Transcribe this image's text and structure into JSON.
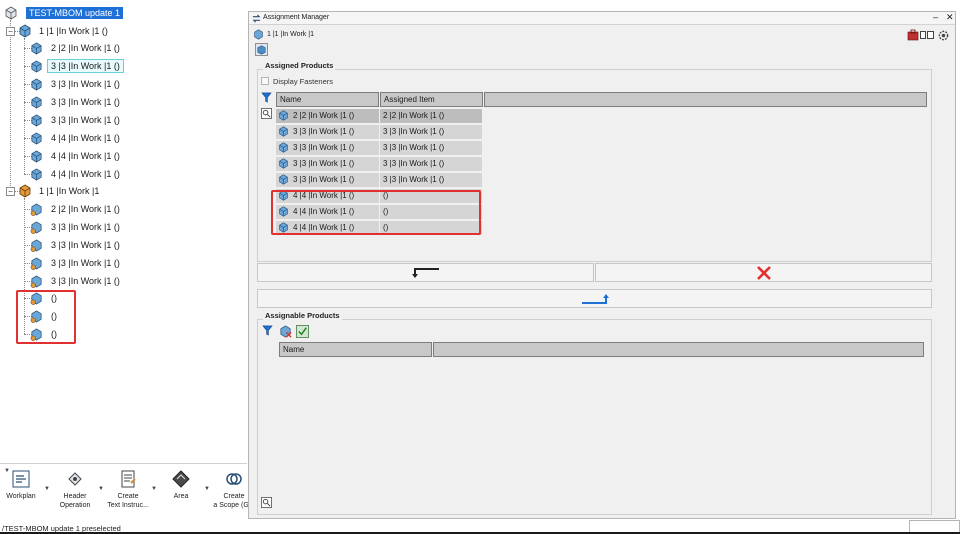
{
  "tree": {
    "root_label": "TEST-MBOM update 1",
    "group1": {
      "label": "1 |1 |In Work |1 ()",
      "children": [
        "2 |2 |In Work |1 ()",
        "3 |3 |In Work |1 ()",
        "3 |3 |In Work |1 ()",
        "3 |3 |In Work |1 ()",
        "3 |3 |In Work |1 ()",
        "4 |4 |In Work |1 ()",
        "4 |4 |In Work |1 ()",
        "4 |4 |In Work |1 ()"
      ]
    },
    "group2": {
      "label": "1 |1 |In Work |1",
      "children": [
        "2 |2 |In Work |1 ()",
        "3 |3 |In Work |1 ()",
        "3 |3 |In Work |1 ()",
        "3 |3 |In Work |1 ()",
        "3 |3 |In Work |1 ()",
        "()",
        "()",
        "()"
      ]
    }
  },
  "bottom_toolbar": {
    "items": [
      {
        "label": "Workplan",
        "icon": "workplan-icon"
      },
      {
        "label": "Header\nOperation",
        "icon": "header-operation-icon"
      },
      {
        "label": "Create\nText Instruc...",
        "icon": "text-instruction-icon"
      },
      {
        "label": "Area",
        "icon": "area-icon"
      },
      {
        "label": "Create\na Scope (G...",
        "icon": "scope-icon"
      }
    ]
  },
  "status_bar": {
    "text": "/TEST-MBOM update 1 preselected"
  },
  "dialog": {
    "title": "Assignment Manager",
    "context_label": "1 |1 |In Work |1",
    "assigned": {
      "title": "Assigned Products",
      "display_fasteners_label": "Display Fasteners",
      "col_name": "Name",
      "col_assigned": "Assigned Item",
      "rows": [
        {
          "name": "2 |2 |In Work |1 ()",
          "assigned": "2 |2 |In Work |1 ()"
        },
        {
          "name": "3 |3 |In Work |1 ()",
          "assigned": "3 |3 |In Work |1 ()"
        },
        {
          "name": "3 |3 |In Work |1 ()",
          "assigned": "3 |3 |In Work |1 ()"
        },
        {
          "name": "3 |3 |In Work |1 ()",
          "assigned": "3 |3 |In Work |1 ()"
        },
        {
          "name": "3 |3 |In Work |1 ()",
          "assigned": "3 |3 |In Work |1 ()"
        },
        {
          "name": "4 |4 |In Work |1 ()",
          "assigned": "()"
        },
        {
          "name": "4 |4 |In Work |1 ()",
          "assigned": "()"
        },
        {
          "name": "4 |4 |In Work |1 ()",
          "assigned": "()"
        }
      ]
    },
    "assignable": {
      "title": "Assignable Products",
      "col_name": "Name"
    }
  },
  "colors": {
    "selection": "#1e6fd6",
    "highlight_box": "#e03030",
    "remove_icon": "#e03030",
    "assign_arrow": "#1e6fd6"
  }
}
